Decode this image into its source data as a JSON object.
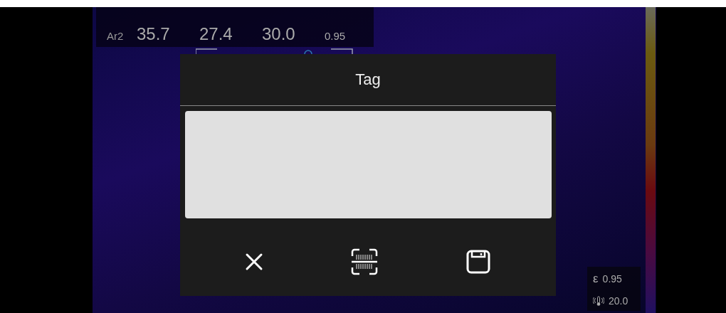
{
  "measurements": [
    {
      "label": "Ar2",
      "max": "35.7",
      "min": "27.4",
      "avg": "30.0",
      "emissivity": "0.95"
    }
  ],
  "dialog": {
    "title": "Tag",
    "buttons": [
      {
        "kind": "cancel"
      },
      {
        "kind": "scan"
      },
      {
        "kind": "save"
      }
    ]
  },
  "status": {
    "emissivity_symbol": "ε",
    "emissivity": "0.95",
    "ambient": "20.0"
  }
}
